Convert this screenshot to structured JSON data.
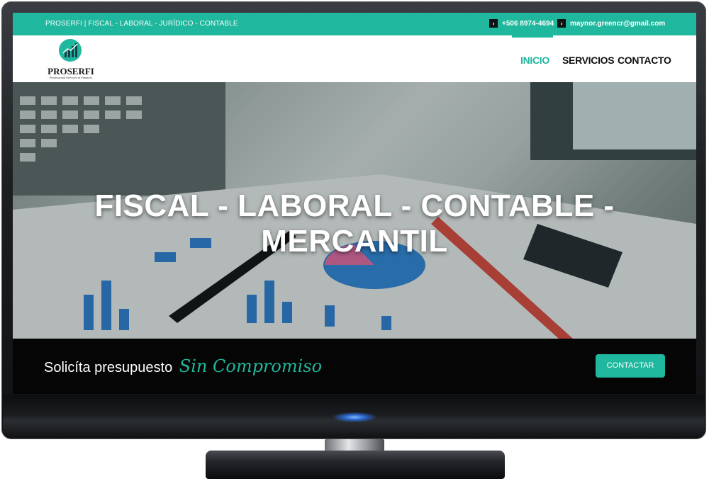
{
  "colors": {
    "accent": "#1fb79d",
    "topbar_bg": "#1fb79d",
    "cta_bg": "#050505",
    "nav_text": "#111111"
  },
  "topbar": {
    "title": "PROSERFI | FISCAL - LABORAL - JURÍDICO - CONTABLE",
    "phone": "+506 8974-4694",
    "email": "maynor.greencr@gmail.com",
    "arrow_icon": "chevron-right-icon"
  },
  "logo": {
    "name": "PROSERFI",
    "tagline": "Professional Services in Finances",
    "icon": "growth-chart-icon"
  },
  "nav": {
    "items": [
      {
        "label": "INICIO",
        "active": true
      },
      {
        "label": "SERVICIOS",
        "active": false
      },
      {
        "label": "CONTACTO",
        "active": false
      }
    ]
  },
  "hero": {
    "title": "FISCAL - LABORAL - CONTABLE - MERCANTIL"
  },
  "cta": {
    "text": "Solicíta presupuesto",
    "accent": "Sin Compromiso",
    "button_label": "CONTACTAR"
  }
}
